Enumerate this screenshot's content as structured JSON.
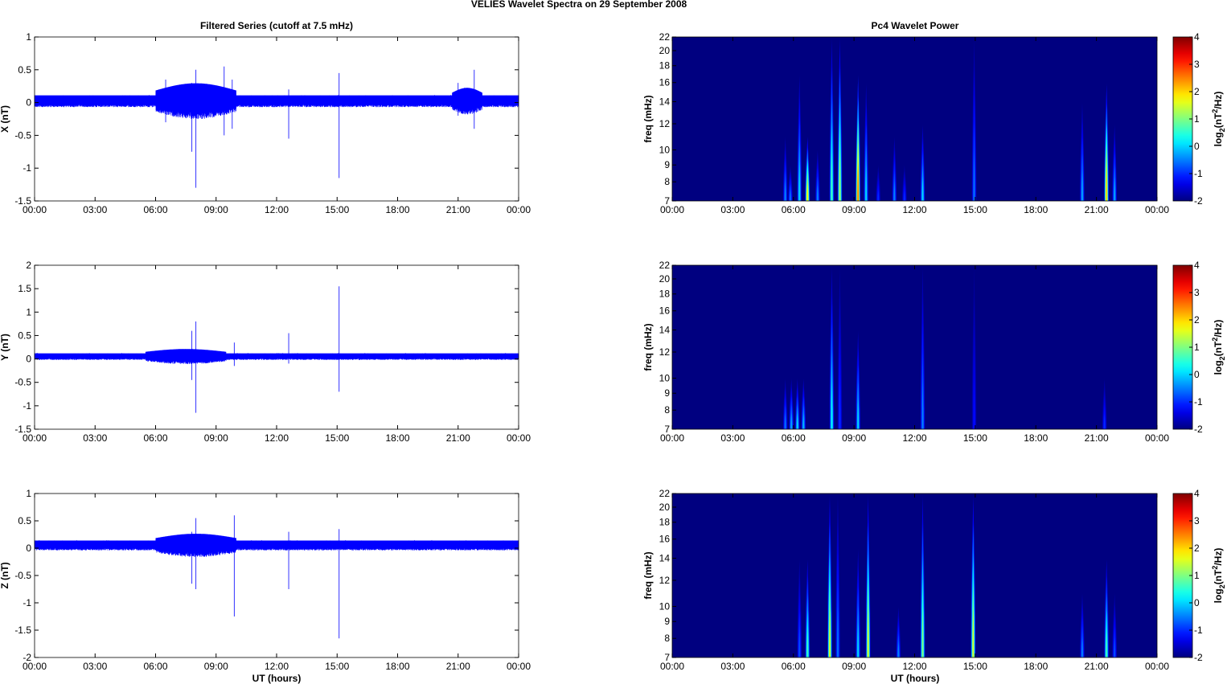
{
  "chart_data": {
    "type": "mixed",
    "title": "VELIES Wavelet Spectra on 29 September 2008",
    "left_title": "Filtered Series (cutoff at 7.5 mHz)",
    "right_title": "Pc4 Wavelet Power",
    "xlabel": "UT (hours)",
    "x_ticks": [
      "00:00",
      "03:00",
      "06:00",
      "09:00",
      "12:00",
      "15:00",
      "18:00",
      "21:00",
      "00:00"
    ],
    "xlim_hours": [
      0,
      24
    ],
    "series_color": "#0000ff",
    "time_series": [
      {
        "name": "X",
        "ylabel": "X (nT)",
        "ylim": [
          -1.5,
          1
        ],
        "yticks": [
          1,
          0.5,
          0,
          -0.5,
          -1,
          -1.5
        ],
        "yticklabels": [
          "1",
          "0.5",
          "0",
          "-0.5",
          "-1",
          "-1.5"
        ],
        "offset": 0.02,
        "noise": 0.09,
        "bursts": [
          [
            6.0,
            10.0,
            0.22
          ],
          [
            20.7,
            22.2,
            0.15
          ]
        ],
        "spikes": [
          [
            6.5,
            0.35,
            -0.3
          ],
          [
            7.8,
            0.3,
            -0.75
          ],
          [
            8.0,
            0.5,
            -1.3
          ],
          [
            9.4,
            0.55,
            -0.5
          ],
          [
            9.8,
            0.35,
            -0.4
          ],
          [
            12.6,
            0.2,
            -0.55
          ],
          [
            15.1,
            0.45,
            -1.15
          ],
          [
            21.0,
            0.3,
            -0.2
          ],
          [
            21.8,
            0.5,
            -0.4
          ]
        ]
      },
      {
        "name": "Y",
        "ylabel": "Y (nT)",
        "ylim": [
          -1.5,
          2
        ],
        "yticks": [
          2,
          1.5,
          1,
          0.5,
          0,
          -0.5,
          -1,
          -1.5
        ],
        "yticklabels": [
          "2",
          "1.5",
          "1",
          "0.5",
          "0",
          "-0.5",
          "-1",
          "-1.5"
        ],
        "offset": 0.05,
        "noise": 0.07,
        "bursts": [
          [
            5.5,
            9.5,
            0.12
          ]
        ],
        "spikes": [
          [
            7.8,
            0.6,
            -0.45
          ],
          [
            8.0,
            0.8,
            -1.15
          ],
          [
            9.9,
            0.35,
            -0.15
          ],
          [
            12.6,
            0.55,
            -0.1
          ],
          [
            15.1,
            1.55,
            -0.7
          ]
        ]
      },
      {
        "name": "Z",
        "ylabel": "Z (nT)",
        "ylim": [
          -2,
          1
        ],
        "yticks": [
          1,
          0.5,
          0,
          -0.5,
          -1,
          -1.5,
          -2
        ],
        "yticklabels": [
          "1",
          "0.5",
          "0",
          "-0.5",
          "-1",
          "-1.5",
          "-2"
        ],
        "offset": 0.05,
        "noise": 0.09,
        "bursts": [
          [
            6.0,
            10.0,
            0.16
          ]
        ],
        "spikes": [
          [
            7.8,
            0.3,
            -0.65
          ],
          [
            8.0,
            0.55,
            -0.75
          ],
          [
            9.9,
            0.6,
            -1.25
          ],
          [
            12.6,
            0.3,
            -0.75
          ],
          [
            15.1,
            0.35,
            -1.65
          ]
        ]
      }
    ],
    "spectra": [
      {
        "name": "X",
        "ylabel": "freq (mHz)",
        "yscale": "log",
        "ylim": [
          7,
          22
        ],
        "yticks": [
          7,
          8,
          9,
          10,
          12,
          14,
          16,
          18,
          20,
          22
        ],
        "events": [
          [
            5.6,
            11,
            -0.5
          ],
          [
            5.85,
            9,
            -0.6
          ],
          [
            6.3,
            17,
            0
          ],
          [
            6.7,
            11,
            1.8
          ],
          [
            7.2,
            10,
            -0.5
          ],
          [
            7.9,
            22,
            0.6
          ],
          [
            8.3,
            22,
            1.2
          ],
          [
            9.2,
            17,
            2.5
          ],
          [
            9.6,
            16,
            0
          ],
          [
            10.2,
            9,
            -1
          ],
          [
            11.0,
            11,
            -0.5
          ],
          [
            11.5,
            9,
            -1
          ],
          [
            12.4,
            12,
            0
          ],
          [
            14.95,
            22,
            -0.6
          ],
          [
            20.3,
            14,
            -0.3
          ],
          [
            21.5,
            16,
            2
          ],
          [
            21.9,
            12,
            -0.3
          ]
        ]
      },
      {
        "name": "Y",
        "ylabel": "freq (mHz)",
        "yscale": "log",
        "ylim": [
          7,
          22
        ],
        "yticks": [
          7,
          8,
          9,
          10,
          12,
          14,
          16,
          18,
          20,
          22
        ],
        "events": [
          [
            5.6,
            10,
            -0.6
          ],
          [
            5.9,
            10,
            -0.3
          ],
          [
            6.2,
            10,
            0
          ],
          [
            6.5,
            10,
            -0.2
          ],
          [
            7.9,
            22,
            0.2
          ],
          [
            8.3,
            22,
            -1
          ],
          [
            9.2,
            14,
            0
          ],
          [
            12.4,
            22,
            -0.5
          ],
          [
            14.95,
            22,
            -1.2
          ],
          [
            21.4,
            10,
            -1
          ]
        ]
      },
      {
        "name": "Z",
        "ylabel": "freq (mHz)",
        "yscale": "log",
        "ylim": [
          7,
          22
        ],
        "yticks": [
          7,
          8,
          9,
          10,
          12,
          14,
          16,
          18,
          20,
          22
        ],
        "events": [
          [
            6.3,
            14,
            -0.8
          ],
          [
            6.7,
            14,
            0.6
          ],
          [
            7.8,
            22,
            1.5
          ],
          [
            8.2,
            22,
            -0.6
          ],
          [
            9.2,
            15,
            0
          ],
          [
            9.7,
            22,
            1.5
          ],
          [
            11.2,
            10,
            -0.5
          ],
          [
            12.4,
            22,
            1
          ],
          [
            14.9,
            22,
            1.5
          ],
          [
            20.3,
            11,
            -0.5
          ],
          [
            21.5,
            14,
            0.6
          ],
          [
            21.9,
            11,
            -0.8
          ]
        ]
      }
    ],
    "colorbar": {
      "label": "log2(nT^2/Hz)",
      "label_main": "log",
      "label_sub": "2",
      "label_rest_a": "(nT",
      "label_sup": "2",
      "label_rest_b": "/Hz)",
      "range": [
        -2,
        4
      ],
      "ticks": [
        "4",
        "3",
        "2",
        "1",
        "0",
        "-1",
        "-2"
      ],
      "colormap": "jet"
    }
  }
}
